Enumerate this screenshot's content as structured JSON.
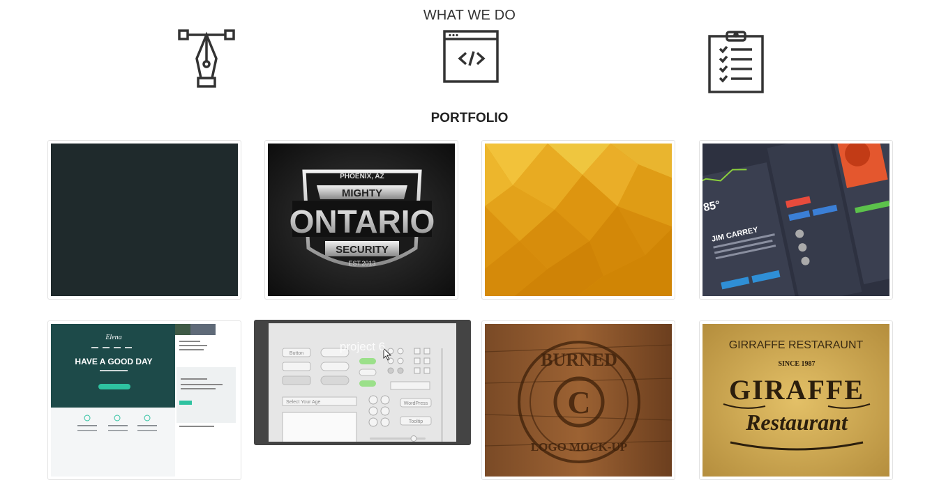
{
  "what_we_do": {
    "title": "WHAT WE DO",
    "services": [
      {
        "icon": "pen-tool-icon"
      },
      {
        "icon": "code-window-icon"
      },
      {
        "icon": "clipboard-checklist-icon"
      }
    ]
  },
  "portfolio": {
    "title": "PORTFOLIO",
    "items": [
      {
        "name": "project-1",
        "caption": ""
      },
      {
        "name": "project-2",
        "caption": "",
        "logo_text": {
          "top": "PHOENIX, AZ",
          "mid": "MIGHTY",
          "main": "ONTARIO",
          "sub": "SECURITY",
          "est": "EST.2013"
        }
      },
      {
        "name": "project-3",
        "caption": ""
      },
      {
        "name": "project-4",
        "caption": "",
        "ui_text": {
          "temp": "85°",
          "name": "JIM CARREY"
        }
      },
      {
        "name": "project-5",
        "caption": "",
        "site_text": {
          "brand": "Elena",
          "headline": "HAVE A GOOD DAY"
        }
      },
      {
        "name": "project-6",
        "caption": "project 6",
        "kit_text": {
          "btn": "Button",
          "select": "Select Your Age",
          "pill": "WordPress",
          "tip": "Tooltip"
        }
      },
      {
        "name": "project-7",
        "caption": "",
        "stamp_text": {
          "top": "BURNED",
          "letter": "C",
          "bottom": "LOGO MOCK-UP"
        }
      },
      {
        "name": "project-8",
        "caption": "GIRRAFFE RESTARAUNT",
        "logo_text": {
          "since": "SINCE 1987",
          "main": "GIRAFFE",
          "script": "Restaurant"
        }
      }
    ]
  }
}
